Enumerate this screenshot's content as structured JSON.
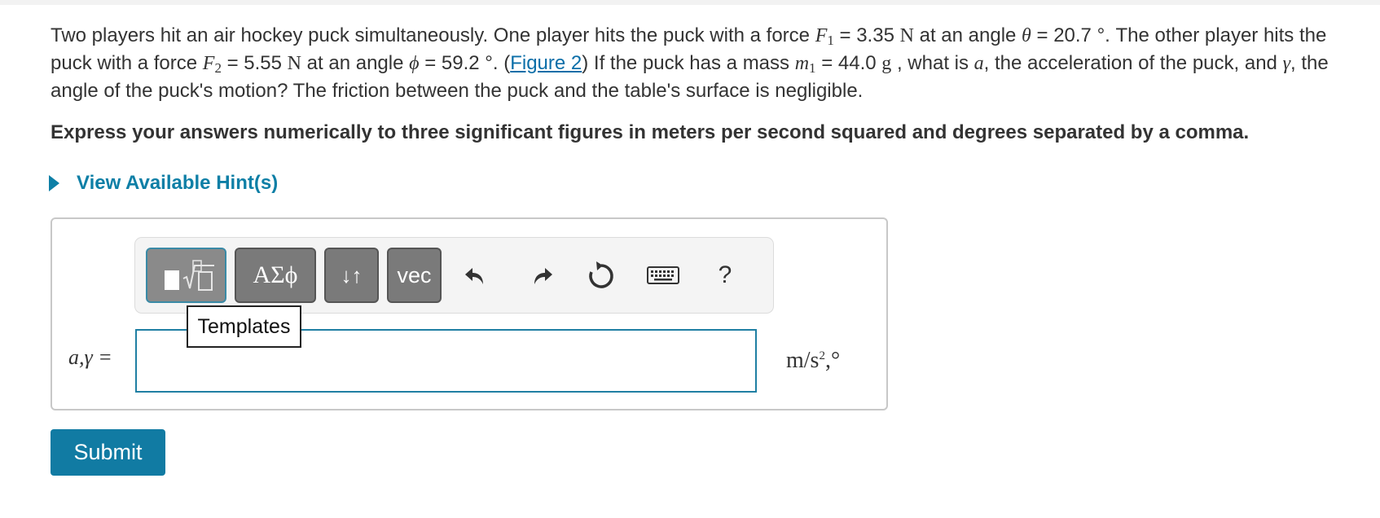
{
  "problem": {
    "intro": "Two players hit an air hockey puck simultaneously. One player hits the puck with a force",
    "F1_symbol": "F",
    "F1_sub": "1",
    "F1_value": " = 3.35",
    "unit_N": "N",
    "angle1_text": " at an angle",
    "theta": "θ",
    "theta_value": " = 20.7 °.",
    "other_player": " The other player hits the puck with a force",
    "F2_symbol": "F",
    "F2_sub": "2",
    "F2_value": " = 5.55",
    "angle2_text": " at an angle",
    "phi": "ϕ",
    "phi_value": " = 59.2 °. (",
    "figure_link": "Figure 2",
    "mass_text": ") If the puck has a mass",
    "m_symbol": "m",
    "m_sub": "1",
    "m_value": " = 44.0",
    "unit_g": "g",
    "question_a": " , what is",
    "a_symbol": "a",
    "question_b": ", the acceleration of the puck, and",
    "gamma_symbol": "γ",
    "question_c": ", the angle of the puck's motion? The friction between the puck and the table's surface is negligible."
  },
  "instruction": "Express your answers numerically to three significant figures in meters per second squared and degrees separated by a comma.",
  "hints_label": "View Available Hint(s)",
  "toolbar": {
    "greek_label": "ΑΣϕ",
    "arrows_label": "↓↑",
    "vec_label": "vec",
    "help_label": "?",
    "templates_tooltip": "Templates"
  },
  "answer": {
    "label": "a,γ =",
    "value": "",
    "units_base": "m/s",
    "units_exp": "2",
    "units_tail": ",°"
  },
  "submit_label": "Submit",
  "colors": {
    "link": "#0b6ea8",
    "accent": "#117ba3",
    "hint": "#0e7fa6",
    "button_gray": "#7a7a7a"
  }
}
